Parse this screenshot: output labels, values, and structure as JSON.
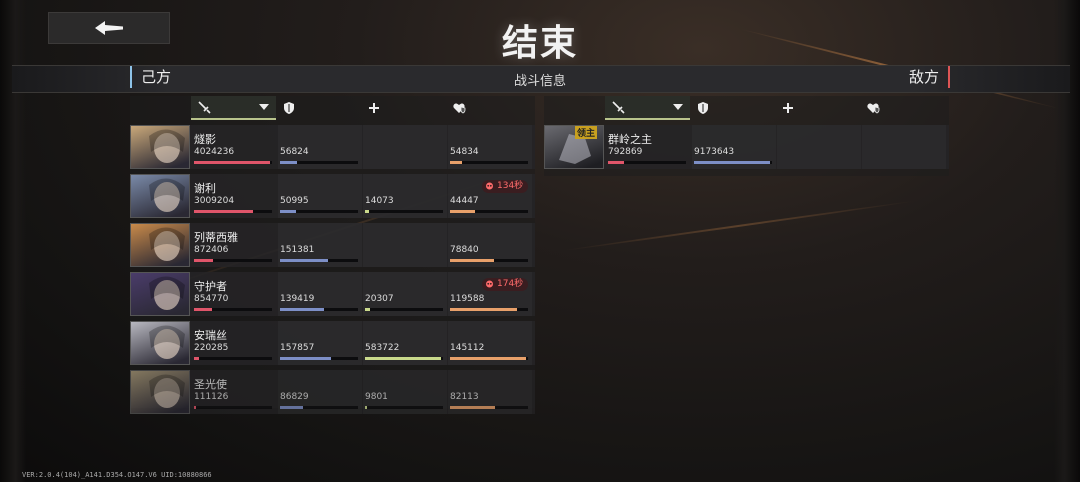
{
  "screen": {
    "title": "结束",
    "center_label": "战斗信息",
    "ally_label": "己方",
    "enemy_label": "敌方",
    "footer": "VER:2.0.4(104)_A141.D354.O147.V6   UID:10880866"
  },
  "columns": [
    "damage-sword-icon",
    "shield-icon",
    "heal-plus-icon",
    "heart-shield-icon"
  ],
  "allies": [
    {
      "name": "燧影",
      "damage": "4024236",
      "damage_pct": 0.98,
      "tank": "56824",
      "tank_pct": 0.22,
      "heal": "",
      "heal_pct": 0,
      "shield": "54834",
      "shield_pct": 0.16,
      "badge": ""
    },
    {
      "name": "谢利",
      "damage": "3009204",
      "damage_pct": 0.75,
      "tank": "50995",
      "tank_pct": 0.2,
      "heal": "14073",
      "heal_pct": 0.05,
      "shield": "44447",
      "shield_pct": 0.32,
      "badge": "134秒"
    },
    {
      "name": "列蒂西雅",
      "damage": "872406",
      "damage_pct": 0.24,
      "tank": "151381",
      "tank_pct": 0.62,
      "heal": "",
      "heal_pct": 0,
      "shield": "78840",
      "shield_pct": 0.56,
      "badge": ""
    },
    {
      "name": "守护者",
      "damage": "854770",
      "damage_pct": 0.23,
      "tank": "139419",
      "tank_pct": 0.57,
      "heal": "20307",
      "heal_pct": 0.06,
      "shield": "119588",
      "shield_pct": 0.86,
      "badge": "174秒"
    },
    {
      "name": "安瑞丝",
      "damage": "220285",
      "damage_pct": 0.06,
      "tank": "157857",
      "tank_pct": 0.65,
      "heal": "583722",
      "heal_pct": 0.98,
      "shield": "145112",
      "shield_pct": 0.98,
      "badge": ""
    },
    {
      "name": "圣光使",
      "damage": "111126",
      "damage_pct": 0.03,
      "tank": "86829",
      "tank_pct": 0.3,
      "heal": "9801",
      "heal_pct": 0.03,
      "shield": "82113",
      "shield_pct": 0.58,
      "badge": ""
    }
  ],
  "enemies": [
    {
      "name": "群岭之主",
      "tag": "领主",
      "damage": "792869",
      "damage_pct": 0.2,
      "tank": "9173643",
      "tank_pct": 0.98
    }
  ],
  "colors": {
    "damage": "#e0556a",
    "tank": "#7d8fc7",
    "heal": "#c9d98c",
    "shield": "#e8a06a",
    "ally_accent": "#8ec3e8",
    "enemy_accent": "#dd5555"
  }
}
